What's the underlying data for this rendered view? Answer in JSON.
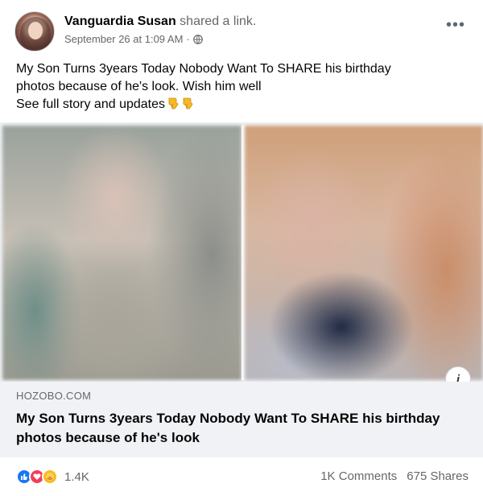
{
  "post": {
    "author_name": "Vanguardia Susan",
    "action_text": "shared a link.",
    "timestamp": "September 26 at 1:09 AM",
    "separator": "·",
    "more_icon": "more-options-icon",
    "privacy_icon": "globe-icon",
    "text_line1": "My Son Turns 3years Today Nobody Want To SHARE his birthday",
    "text_line2": "photos because of he's look. Wish him well",
    "text_line3": "See full story and updates",
    "emojis": [
      "pointing-down-emoji",
      "pointing-down-emoji"
    ]
  },
  "link_preview": {
    "domain": "HOZOBO.COM",
    "title": "My Son Turns 3years Today Nobody Want To SHARE his birthday photos because of he's look",
    "info_icon": "info-icon"
  },
  "footer": {
    "reaction_icons": [
      "like-icon",
      "love-icon",
      "care-icon"
    ],
    "reaction_count": "1.4K",
    "comments": "1K Comments",
    "shares": "675 Shares"
  },
  "colors": {
    "primary_text": "#050505",
    "secondary_text": "#65676b",
    "like_blue": "#1877f2",
    "love_red": "#f33e58",
    "care_yellow": "#f7b928",
    "link_bg": "#f0f2f5"
  }
}
